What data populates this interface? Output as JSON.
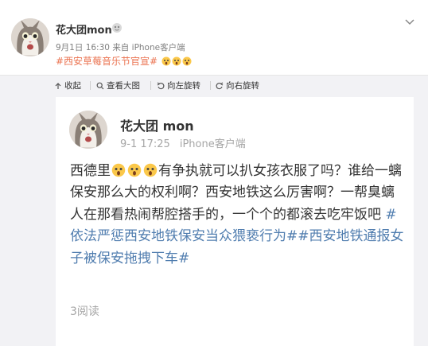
{
  "post": {
    "username": "花大团mon",
    "time": "9月1日 16:30",
    "source": "来自 iPhone客户端",
    "topic": "#西安草莓音乐节官宣#"
  },
  "toolbar": {
    "items": [
      {
        "label": "收起",
        "icon": "collapse-icon"
      },
      {
        "label": "查看大图",
        "icon": "search-icon"
      },
      {
        "label": "向左旋转",
        "icon": "rotate-left-icon"
      },
      {
        "label": "向右旋转",
        "icon": "rotate-right-icon"
      }
    ]
  },
  "screenshot": {
    "username": "花大团 mon",
    "date": "9-1 17:25",
    "client": "iPhone客户端",
    "text_before": "西德里",
    "text_after": "有争执就可以扒女孩衣服了吗？谁给一螭保安那么大的权利啊？西安地铁这么厉害啊？一帮臭螭人在那看热闹帮腔搭手的，一个个的都滚去吃牢饭吧 ",
    "hashtags": "#依法严惩西安地铁保安当众猥亵行为##西安地铁通报女子被保安拖拽下车#",
    "reads": "3阅读"
  },
  "colors": {
    "topic": "#eb7350",
    "hashtag": "#507daf",
    "toolbar_bg": "#f2f2f5"
  }
}
